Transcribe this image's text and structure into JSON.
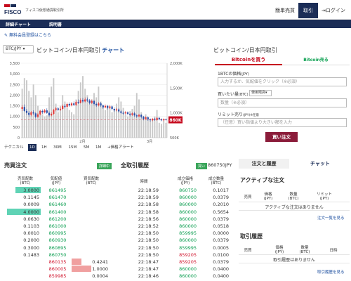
{
  "header": {
    "logo_text": "FISCO",
    "logo_subtitle": "フィスコ仮想通貨取引所",
    "nav_simple": "簡単売買",
    "nav_trade": "取引",
    "nav_login": "ログイン"
  },
  "subnav": {
    "detail_chart": "詳細チャート",
    "manual": "説明書"
  },
  "promo": "無料会員登録はこちら",
  "chart": {
    "pair_select": "BTC/JPY",
    "title": "ビットコイン/日本円取引",
    "title_link": "チャート",
    "price_badge": "860K",
    "timeframes": [
      "テクニカル",
      "1D",
      "1H",
      "30M",
      "15M",
      "5M",
      "1M",
      "+価格アラート"
    ],
    "active_timeframe": "1D"
  },
  "chart_data": {
    "type": "candlestick",
    "x_tick_labels": [
      "2月",
      "3月"
    ],
    "left_axis_ticks": [
      "3,500",
      "3,000",
      "2,500",
      "2,000",
      "1,500",
      "1,000",
      "500",
      "0"
    ],
    "right_axis_ticks": [
      "2,000K",
      "1,500K",
      "1,000K",
      "500K"
    ],
    "ylim_left": [
      0,
      3500
    ],
    "ylim_right": [
      500,
      2000
    ],
    "volume": [
      2300,
      2800,
      2700,
      2200,
      1900,
      2500,
      2000,
      1500,
      1300,
      1100,
      1000,
      1050,
      1900,
      2400,
      2800,
      1600,
      1200,
      1500,
      2000,
      1700,
      1400,
      1300,
      1200,
      1100,
      1800,
      2200,
      2600,
      2900,
      2300,
      2000,
      1700,
      1800,
      2100,
      1900,
      2400,
      1700,
      1500,
      1300,
      1500,
      1400,
      1200,
      1300,
      1600,
      1900,
      1700,
      1400,
      1100,
      1000,
      1250,
      1350,
      1500,
      2100,
      1800,
      1200,
      1000,
      1100,
      900,
      800,
      850,
      1000,
      1300,
      700,
      650,
      800,
      700
    ],
    "candles": [
      {
        "o": 1080,
        "c": 1120,
        "h": 1160,
        "l": 1040
      },
      {
        "o": 1120,
        "c": 1040,
        "h": 1170,
        "l": 1020
      },
      {
        "o": 1040,
        "c": 1000,
        "h": 1080,
        "l": 960
      },
      {
        "o": 1000,
        "c": 960,
        "h": 1040,
        "l": 920
      },
      {
        "o": 960,
        "c": 1010,
        "h": 1040,
        "l": 930
      },
      {
        "o": 1010,
        "c": 990,
        "h": 1050,
        "l": 960
      },
      {
        "o": 990,
        "c": 920,
        "h": 1010,
        "l": 890
      },
      {
        "o": 920,
        "c": 970,
        "h": 1000,
        "l": 900
      },
      {
        "o": 970,
        "c": 1040,
        "h": 1060,
        "l": 950
      },
      {
        "o": 1040,
        "c": 1010,
        "h": 1070,
        "l": 980
      },
      {
        "o": 1010,
        "c": 1050,
        "h": 1080,
        "l": 990
      },
      {
        "o": 1050,
        "c": 1000,
        "h": 1090,
        "l": 980
      },
      {
        "o": 1000,
        "c": 950,
        "h": 1030,
        "l": 920
      },
      {
        "o": 950,
        "c": 980,
        "h": 1010,
        "l": 930
      },
      {
        "o": 980,
        "c": 1060,
        "h": 1080,
        "l": 960
      },
      {
        "o": 1060,
        "c": 1090,
        "h": 1120,
        "l": 1030
      },
      {
        "o": 1090,
        "c": 1060,
        "h": 1120,
        "l": 1030
      },
      {
        "o": 1060,
        "c": 1080,
        "h": 1110,
        "l": 1040
      },
      {
        "o": 1080,
        "c": 1140,
        "h": 1170,
        "l": 1060
      },
      {
        "o": 1140,
        "c": 1120,
        "h": 1180,
        "l": 1090
      },
      {
        "o": 1120,
        "c": 1180,
        "h": 1210,
        "l": 1100
      },
      {
        "o": 1180,
        "c": 1150,
        "h": 1210,
        "l": 1120
      },
      {
        "o": 1150,
        "c": 1190,
        "h": 1220,
        "l": 1130
      },
      {
        "o": 1190,
        "c": 1160,
        "h": 1230,
        "l": 1140
      },
      {
        "o": 1160,
        "c": 1220,
        "h": 1250,
        "l": 1140
      },
      {
        "o": 1220,
        "c": 1200,
        "h": 1270,
        "l": 1180
      },
      {
        "o": 1200,
        "c": 1260,
        "h": 1290,
        "l": 1190
      },
      {
        "o": 1260,
        "c": 1230,
        "h": 1300,
        "l": 1200
      },
      {
        "o": 1230,
        "c": 1270,
        "h": 1310,
        "l": 1210
      },
      {
        "o": 1270,
        "c": 1250,
        "h": 1310,
        "l": 1220
      },
      {
        "o": 1250,
        "c": 1200,
        "h": 1280,
        "l": 1170
      },
      {
        "o": 1200,
        "c": 1240,
        "h": 1270,
        "l": 1180
      },
      {
        "o": 1240,
        "c": 1180,
        "h": 1260,
        "l": 1150
      },
      {
        "o": 1180,
        "c": 1150,
        "h": 1210,
        "l": 1120
      },
      {
        "o": 1150,
        "c": 1190,
        "h": 1220,
        "l": 1130
      },
      {
        "o": 1190,
        "c": 1150,
        "h": 1220,
        "l": 1120
      },
      {
        "o": 1150,
        "c": 1110,
        "h": 1170,
        "l": 1080
      },
      {
        "o": 1110,
        "c": 1140,
        "h": 1170,
        "l": 1090
      },
      {
        "o": 1140,
        "c": 1100,
        "h": 1160,
        "l": 1070
      },
      {
        "o": 1100,
        "c": 1130,
        "h": 1160,
        "l": 1080
      },
      {
        "o": 1130,
        "c": 1080,
        "h": 1150,
        "l": 1050
      },
      {
        "o": 1080,
        "c": 1050,
        "h": 1110,
        "l": 1020
      },
      {
        "o": 1050,
        "c": 1070,
        "h": 1100,
        "l": 1030
      },
      {
        "o": 1070,
        "c": 1030,
        "h": 1090,
        "l": 1000
      },
      {
        "o": 1030,
        "c": 1000,
        "h": 1060,
        "l": 980
      },
      {
        "o": 1000,
        "c": 990,
        "h": 1030,
        "l": 960
      },
      {
        "o": 990,
        "c": 1010,
        "h": 1040,
        "l": 970
      },
      {
        "o": 1010,
        "c": 980,
        "h": 1030,
        "l": 950
      },
      {
        "o": 980,
        "c": 960,
        "h": 1000,
        "l": 930
      },
      {
        "o": 960,
        "c": 990,
        "h": 1010,
        "l": 940
      },
      {
        "o": 990,
        "c": 950,
        "h": 1020,
        "l": 920
      },
      {
        "o": 950,
        "c": 930,
        "h": 970,
        "l": 900
      },
      {
        "o": 930,
        "c": 960,
        "h": 980,
        "l": 910
      },
      {
        "o": 960,
        "c": 920,
        "h": 970,
        "l": 890
      },
      {
        "o": 920,
        "c": 880,
        "h": 940,
        "l": 850
      },
      {
        "o": 880,
        "c": 910,
        "h": 930,
        "l": 860
      },
      {
        "o": 910,
        "c": 870,
        "h": 930,
        "l": 840
      },
      {
        "o": 870,
        "c": 850,
        "h": 890,
        "l": 820
      },
      {
        "o": 850,
        "c": 880,
        "h": 900,
        "l": 830
      },
      {
        "o": 880,
        "c": 860,
        "h": 900,
        "l": 840
      },
      {
        "o": 860,
        "c": 900,
        "h": 920,
        "l": 840
      },
      {
        "o": 900,
        "c": 870,
        "h": 920,
        "l": 850
      },
      {
        "o": 870,
        "c": 850,
        "h": 890,
        "l": 830
      },
      {
        "o": 850,
        "c": 870,
        "h": 890,
        "l": 830
      },
      {
        "o": 870,
        "c": 860,
        "h": 885,
        "l": 845
      }
    ],
    "colors": {
      "up": "#e03a3a",
      "down": "#2a4fa8",
      "volume": "#c9c9c9",
      "price_tag": "#c60a1e"
    }
  },
  "order": {
    "title": "ビットコイン/日本円取引",
    "buy_tab": "Bitcoinを買う",
    "sell_tab": "Bitcoin売る",
    "price_label": "1BTCの価格",
    "price_unit": "(JPY)",
    "price_placeholder": "入力するか、気配値をクリック（※必須）",
    "qty_label": "買いたい量",
    "qty_unit": "(BTC)",
    "qty_unit_select": "使用残高",
    "qty_placeholder": "数量（※必須）",
    "limit_label": "リミット売り",
    "limit_unit": "(JPY)※任意",
    "limit_placeholder": "（任意）買い指値より大きい額を入力",
    "submit": "買い注文"
  },
  "board": {
    "title": "売買注文",
    "badge": "詳細中",
    "col_sell": "売気配数",
    "col_price": "気配値",
    "col_buy": "買気配数",
    "unit_btc": "(BTC)",
    "unit_jpy": "(JPY)",
    "rows": [
      {
        "sell": "3.0000",
        "price": "861495",
        "buy": "",
        "sellbar": 0.75,
        "buybar": 0
      },
      {
        "sell": "0.1145",
        "price": "861470",
        "buy": "",
        "sellbar": 0,
        "buybar": 0
      },
      {
        "sell": "0.0009",
        "price": "861460",
        "buy": "",
        "sellbar": 0,
        "buybar": 0
      },
      {
        "sell": "4.0000",
        "price": "861400",
        "buy": "",
        "sellbar": 1.0,
        "buybar": 0
      },
      {
        "sell": "0.0630",
        "price": "861200",
        "buy": "",
        "sellbar": 0,
        "buybar": 0
      },
      {
        "sell": "0.1103",
        "price": "861000",
        "buy": "",
        "sellbar": 0,
        "buybar": 0
      },
      {
        "sell": "0.0010",
        "price": "860995",
        "buy": "",
        "sellbar": 0,
        "buybar": 0
      },
      {
        "sell": "0.2000",
        "price": "860930",
        "buy": "",
        "sellbar": 0,
        "buybar": 0
      },
      {
        "sell": "0.3000",
        "price": "860895",
        "buy": "",
        "sellbar": 0,
        "buybar": 0
      },
      {
        "sell": "0.1483",
        "price": "860750",
        "buy": "",
        "sellbar": 0,
        "buybar": 0
      },
      {
        "sell": "",
        "price": "860135",
        "buy": "0.4241",
        "sellbar": 0,
        "buybar": 0.35
      },
      {
        "sell": "",
        "price": "860005",
        "buy": "1.0000",
        "sellbar": 0,
        "buybar": 0.7
      },
      {
        "sell": "",
        "price": "859985",
        "buy": "0.0004",
        "sellbar": 0,
        "buybar": 0
      }
    ]
  },
  "history": {
    "title": "全取引履歴",
    "badge": "買い",
    "last": "860750JPY",
    "col_time": "時間",
    "col_price": "成立価格",
    "col_qty": "成立数量",
    "unit_jpy": "(JPY)",
    "unit_btc": "(BTC)",
    "rows": [
      {
        "time": "22:18:59",
        "price": "860750",
        "qty": "0.1017",
        "side": "buy"
      },
      {
        "time": "22:18:59",
        "price": "860000",
        "qty": "0.0379",
        "side": "buy"
      },
      {
        "time": "22:18:58",
        "price": "860000",
        "qty": "0.2010",
        "side": "buy"
      },
      {
        "time": "22:18:58",
        "price": "860000",
        "qty": "0.5654",
        "side": "buy"
      },
      {
        "time": "22:18:56",
        "price": "860000",
        "qty": "0.0379",
        "side": "buy"
      },
      {
        "time": "22:18:52",
        "price": "860000",
        "qty": "0.0518",
        "side": "buy"
      },
      {
        "time": "22:18:50",
        "price": "859995",
        "qty": "0.0000",
        "side": "buy"
      },
      {
        "time": "22:18:50",
        "price": "860000",
        "qty": "0.0379",
        "side": "buy"
      },
      {
        "time": "22:18:50",
        "price": "859995",
        "qty": "0.0005",
        "side": "buy"
      },
      {
        "time": "22:18:50",
        "price": "859205",
        "qty": "0.0100",
        "side": "sell"
      },
      {
        "time": "22:18:47",
        "price": "859205",
        "qty": "0.0379",
        "side": "sell"
      },
      {
        "time": "22:18:47",
        "price": "860000",
        "qty": "0.0400",
        "side": "buy"
      },
      {
        "time": "22:18:46",
        "price": "860000",
        "qty": "0.0400",
        "side": "buy"
      }
    ]
  },
  "right": {
    "tab_orders": "注文と履歴",
    "tab_chat": "チャット",
    "active_title": "アクティブな注文",
    "col_side": "売買",
    "col_price": "価格",
    "col_qty": "数量",
    "col_limit": "リミット",
    "unit_jpy": "(JPY)",
    "unit_btc": "(BTC)",
    "empty_active": "アクティブな注文はありません",
    "link_orders": "注文一覧を見る",
    "history_title": "取引履歴",
    "col_time": "日時",
    "empty_history": "取引履歴はありません",
    "link_history": "取引履歴を見る"
  }
}
